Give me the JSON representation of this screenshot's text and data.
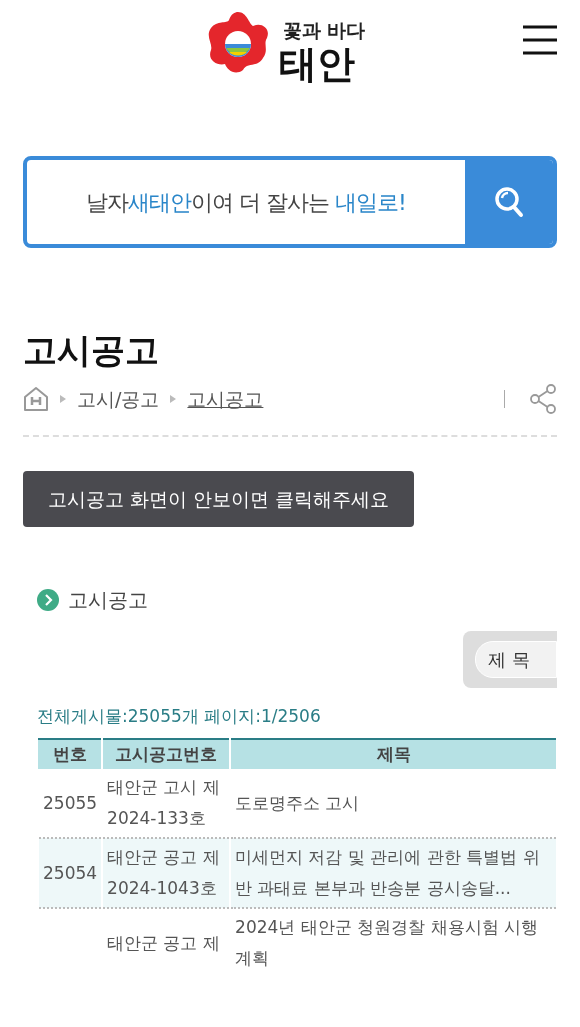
{
  "logo": {
    "slogan": "꽃과 바다",
    "name": "태안"
  },
  "banner": {
    "segments": [
      {
        "text": "날자",
        "highlight": false
      },
      {
        "text": "새태안",
        "highlight": true
      },
      {
        "text": "이여 더 잘사는 ",
        "highlight": false
      },
      {
        "text": "내일로!",
        "highlight": true
      }
    ]
  },
  "page_title": "고시공고",
  "breadcrumb": [
    {
      "label": "고시/공고",
      "current": false
    },
    {
      "label": "고시공고",
      "current": true
    }
  ],
  "notice_button": "고시공고 화면이 안보이면 클릭해주세요",
  "section_title": "고시공고",
  "search_select": {
    "value": "제 목"
  },
  "summary": "전체게시물:25055개 페이지:1/2506",
  "table": {
    "columns": [
      "번호",
      "고시공고번호",
      "제목"
    ],
    "rows": [
      {
        "number": "25055",
        "notice_no": "태안군 고시 제 2024-133호",
        "title": "도로명주소 고시"
      },
      {
        "number": "25054",
        "notice_no": "태안군 공고 제 2024-1043호",
        "title": "미세먼지 저감 및 관리에 관한 특별법 위반 과태료 본부과 반송분 공시송달..."
      },
      {
        "notice_no": "태안군 공고 제",
        "title": "2024년 태안군 청원경찰 채용시험 시행계획"
      }
    ]
  }
}
